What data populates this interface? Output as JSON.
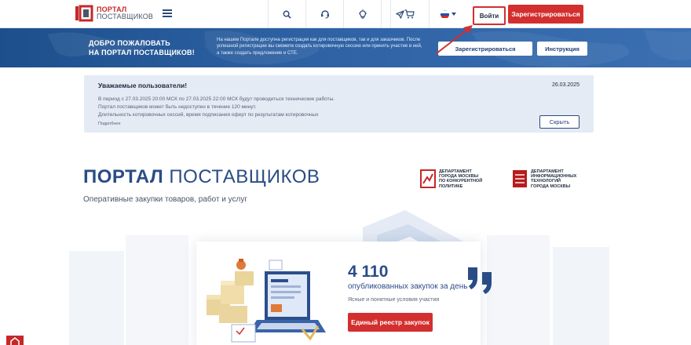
{
  "header": {
    "logo_line1": "ПОРТАЛ",
    "logo_line2": "ПОСТАВЩИКОВ",
    "icons": [
      "search-icon",
      "support-icon",
      "lightbulb-icon",
      "send-icon",
      "cart-icon"
    ],
    "language": "ru",
    "login_label": "Войти",
    "register_label": "Зарегистрироваться"
  },
  "banner": {
    "title_line1": "ДОБРО ПОЖАЛОВАТЬ",
    "title_line2": "НА ПОРТАЛ ПОСТАВЩИКОВ!",
    "text": "На нашем Портале доступна регистрация как для поставщиков, так и для заказчиков. После успешной регистрации вы сможете создать котировочную сессию или принять участие в ней, а также создать предложение и СТЕ.",
    "register_label": "Зарегистрироваться",
    "instruction_label": "Инструкция"
  },
  "notice": {
    "title": "Уважаемые пользователи!",
    "date": "26.03.2025",
    "line1": "В период с 27.03.2025 20:00 МСК по 27.03.2025 22:00 МСК будут проводиться технические работы.",
    "line2": "Портал поставщиков может быть недоступен в течение 120 минут.",
    "line3": "Длительность котировочных сессий, время подписания оферт по результатам котировочных",
    "more": "Подробнее",
    "hide_label": "Скрыть"
  },
  "hero": {
    "title_bold": "ПОРТАЛ",
    "title_rest": "ПОСТАВЩИКОВ",
    "subtitle": "Оперативные закупки товаров, работ и услуг",
    "dept1": [
      "ДЕПАРТАМЕНТ",
      "ГОРОДА МОСКВЫ",
      "ПО КОНКУРЕНТНОЙ",
      "ПОЛИТИКЕ"
    ],
    "dept2": [
      "ДЕПАРТАМЕНТ",
      "ИНФОРМАЦИОННЫХ",
      "ТЕХНОЛОГИЙ",
      "ГОРОДА МОСКВЫ"
    ]
  },
  "stats": {
    "number": "4 110",
    "label": "опубликованных закупок за день",
    "description": "Ясные и понятные условия участия",
    "registry_label": "Единый реестр закупок"
  },
  "colors": {
    "brand_red": "#d32f2f",
    "brand_blue": "#2a4c86",
    "banner_blue": "#2e62a4"
  }
}
